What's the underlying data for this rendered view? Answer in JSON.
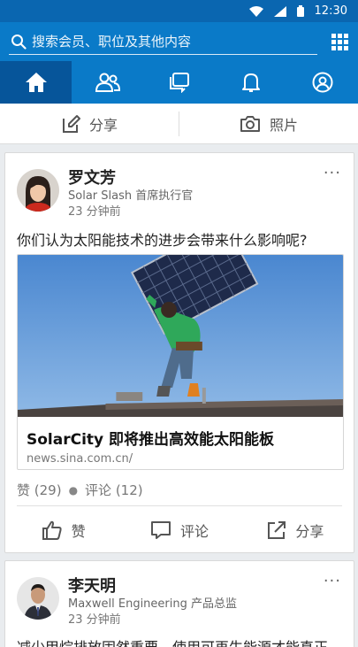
{
  "status_bar": {
    "time": "12:30"
  },
  "search": {
    "placeholder": "搜索会员、职位及其他内容"
  },
  "nav": {
    "items": [
      "home",
      "network",
      "messages",
      "notifications",
      "profile"
    ]
  },
  "share_bar": {
    "share_label": "分享",
    "photo_label": "照片"
  },
  "posts": [
    {
      "author": "罗文芳",
      "title": "Solar Slash 首席执行官",
      "time": "23 分钟前",
      "text": "你们认为太阳能技术的进步会带来什么影响呢?",
      "link": {
        "title": "SolarCity 即将推出高效能太阳能板",
        "domain": "news.sina.com.cn/"
      },
      "likes": "赞 (29)",
      "comments": "评论 (12)",
      "actions": {
        "like": "赞",
        "comment": "评论",
        "share": "分享"
      }
    },
    {
      "author": "李天明",
      "title": "Maxwell Engineering 产品总监",
      "time": "23 分钟前",
      "text": "减少甲烷排放固然重要，使用可再生能源才能真正"
    }
  ],
  "colors": {
    "brand": "#0a7ac8",
    "brand_dark": "#06559a",
    "status": "#0a66b0"
  }
}
